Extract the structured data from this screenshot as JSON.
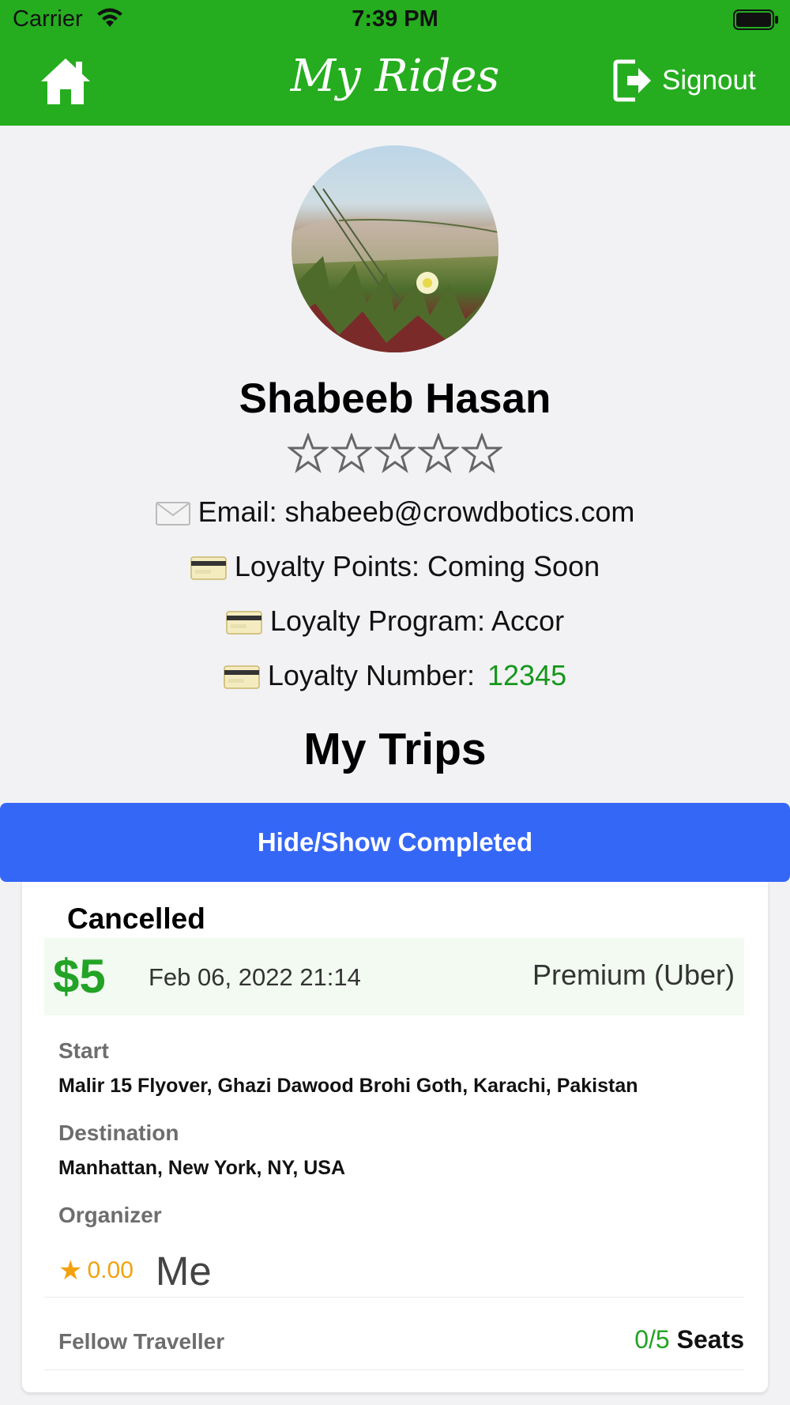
{
  "status_bar": {
    "carrier": "Carrier",
    "time": "7:39 PM"
  },
  "nav": {
    "title": "My Rides",
    "signout_label": "Signout",
    "home_icon": "home-icon",
    "signout_icon": "signout-icon"
  },
  "profile": {
    "name": "Shabeeb Hasan",
    "rating_stars": 0,
    "rating_max": 5,
    "email_line": "Email: shabeeb@crowdbotics.com",
    "loyalty_points_line": "Loyalty Points: Coming Soon",
    "loyalty_program_line": "Loyalty Program: Accor",
    "loyalty_number_label": "Loyalty Number:",
    "loyalty_number": "12345"
  },
  "trips": {
    "title": "My Trips",
    "toggle_label": "Hide/Show Completed",
    "items": [
      {
        "status": "Cancelled",
        "price": "$5",
        "date": "Feb 06, 2022 21:14",
        "service": "Premium (Uber)",
        "start_label": "Start",
        "start": "Malir 15 Flyover, Ghazi Dawood Brohi Goth, Karachi, Pakistan",
        "destination_label": "Destination",
        "destination": "Manhattan, New York, NY, USA",
        "organizer_label": "Organizer",
        "organizer_rating": "0.00",
        "organizer_name": "Me",
        "fellow_label": "Fellow Traveller",
        "seats_count": "0/5",
        "seats_label": "Seats"
      }
    ]
  },
  "colors": {
    "header_green": "#25ad1f",
    "button_blue": "#3567f7",
    "price_green": "#22a325",
    "rating_orange": "#f2a20f"
  }
}
